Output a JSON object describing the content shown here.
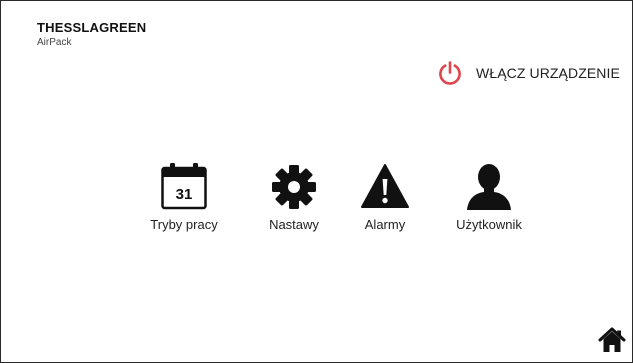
{
  "brand": {
    "name": "THESSLAGREEN",
    "product": "AirPack"
  },
  "power": {
    "label": "WŁĄCZ URZĄDZENIE",
    "icon": "power-icon",
    "color": "#e0454b"
  },
  "menu": {
    "items": [
      {
        "label": "Tryby pracy",
        "icon": "calendar-icon",
        "day": "31"
      },
      {
        "label": "Nastawy",
        "icon": "gear-icon"
      },
      {
        "label": "Alarmy",
        "icon": "warning-icon"
      },
      {
        "label": "Użytkownik",
        "icon": "user-icon"
      }
    ]
  },
  "home": {
    "icon": "home-icon"
  }
}
